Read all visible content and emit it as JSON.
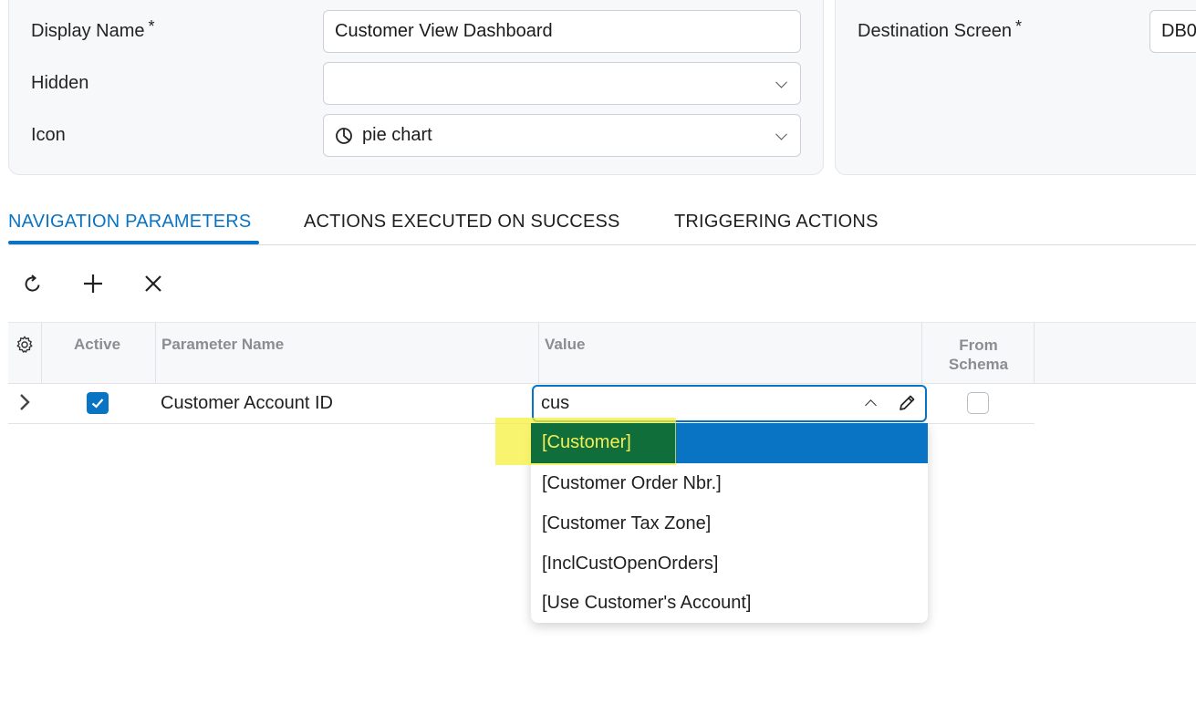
{
  "form": {
    "display_name_label": "Display Name",
    "display_name_value": "Customer View Dashboard",
    "hidden_label": "Hidden",
    "hidden_value": "",
    "icon_label": "Icon",
    "icon_value": "pie chart",
    "icon_name": "pie-chart-icon",
    "destination_screen_label": "Destination Screen",
    "destination_screen_value": "DB0",
    "required_marker": "*"
  },
  "tabs": [
    {
      "label": "NAVIGATION PARAMETERS",
      "active": true
    },
    {
      "label": "ACTIONS EXECUTED ON SUCCESS",
      "active": false
    },
    {
      "label": "TRIGGERING ACTIONS",
      "active": false
    }
  ],
  "toolbar": {
    "icons": [
      "refresh-icon",
      "add-icon",
      "delete-icon"
    ]
  },
  "grid": {
    "columns": [
      "Active",
      "Parameter Name",
      "Value",
      "From\nSchema"
    ],
    "rows": [
      {
        "active": true,
        "parameter_name": "Customer Account ID",
        "value": "cus",
        "from_schema": false
      }
    ]
  },
  "dropdown": {
    "options": [
      "[Customer]",
      "[Customer Order Nbr.]",
      "[Customer Tax Zone]",
      "[InclCustOpenOrders]",
      "[Use Customer's Account]"
    ],
    "selected_index": 0
  },
  "colors": {
    "accent": "#0a74c4",
    "highlight_yellow": "#f5f03c",
    "highlight_green": "#106e3a"
  }
}
